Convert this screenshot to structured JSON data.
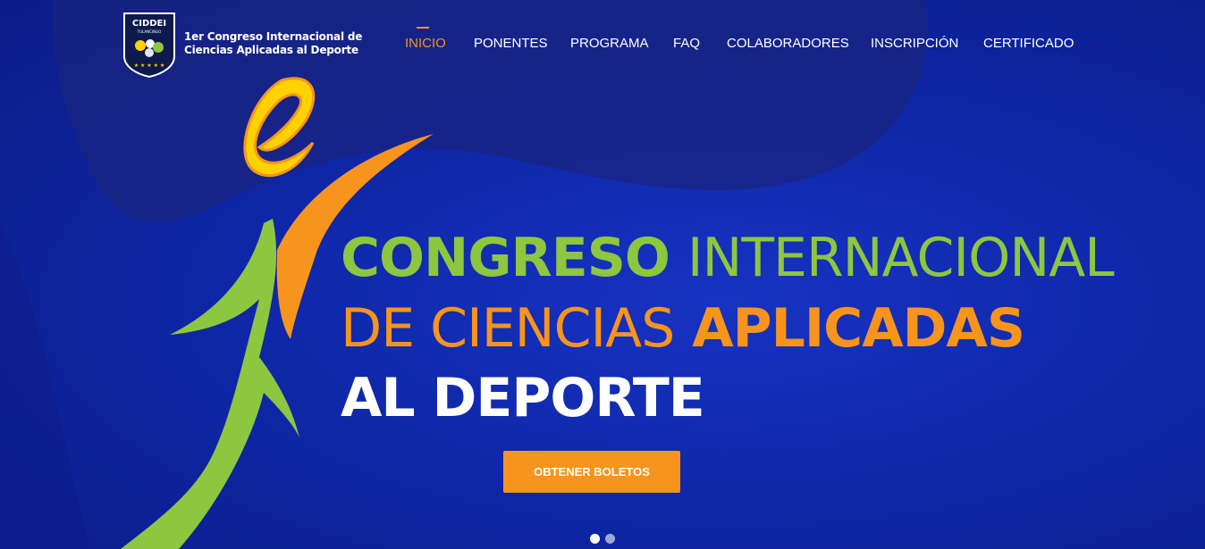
{
  "logo": {
    "badge_label": "CIDDEI",
    "badge_sub": "TULANCINGO",
    "name_line1": "1er Congreso Internacional de",
    "name_line2": "Ciencias Aplicadas al Deporte"
  },
  "nav": {
    "items": [
      {
        "label": "INICIO",
        "active": true
      },
      {
        "label": "PONENTES",
        "active": false
      },
      {
        "label": "PROGRAMA",
        "active": false
      },
      {
        "label": "FAQ",
        "active": false
      },
      {
        "label": "COLABORADORES",
        "active": false
      },
      {
        "label": "INSCRIPCIÓN",
        "active": false
      },
      {
        "label": "CERTIFICADO",
        "active": false
      }
    ]
  },
  "hero": {
    "line1_bold": "CONGRESO",
    "line1_thin": "INTERNACIONAL",
    "line2_thin": "DE CIENCIAS",
    "line2_bold": "APLICADAS",
    "line3_bold": "AL DEPORTE",
    "cta_label": "OBTENER BOLETOS"
  },
  "slider": {
    "slide_count": 2,
    "active_index": 0
  },
  "colors": {
    "background": "#0f27a8",
    "accent_orange": "#f7941d",
    "accent_green": "#8dc63f",
    "accent_yellow": "#ffd200",
    "text": "#ffffff"
  }
}
